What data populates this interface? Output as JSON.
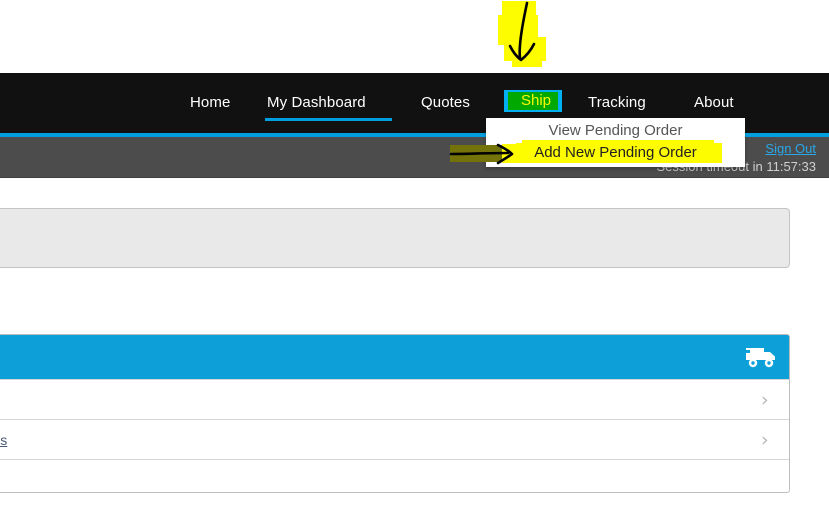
{
  "navbar": {
    "items": [
      {
        "label": "Home",
        "name": "nav-item-home",
        "active": false
      },
      {
        "label": "My Dashboard",
        "name": "nav-item-my-dashboard",
        "active": true
      },
      {
        "label": "Quotes",
        "name": "nav-item-quotes",
        "active": false
      },
      {
        "label": "Ship",
        "name": "nav-item-ship",
        "active": false,
        "highlighted": true
      },
      {
        "label": "Tracking",
        "name": "nav-item-tracking",
        "active": false
      },
      {
        "label": "About",
        "name": "nav-item-about",
        "active": false
      }
    ],
    "settings_icon": "gear-icon",
    "active_underline_color": "#00a0e0",
    "background_color": "#111111",
    "ship_highlight_background": "#00a800",
    "ship_highlight_text_color": "#f9f900",
    "ship_outer_highlight_color": "#00b0f0"
  },
  "dropdown": {
    "items": [
      {
        "label": "View Pending Order",
        "name": "dropdown-item-view-pending-order",
        "highlighted": false
      },
      {
        "label": "Add New Pending Order",
        "name": "dropdown-item-add-new-pending-order",
        "highlighted": true
      }
    ],
    "highlight_color": "#fdfd00",
    "background_color": "#ffffff"
  },
  "session_bar": {
    "sign_out_label": "Sign Out",
    "timeout_text": "Session timeout in 11:57:33",
    "timeout_value": "11:57:33",
    "background_color": "#4c4c4c",
    "link_color": "#29a7e8"
  },
  "annotations": [
    {
      "name": "down-arrow-annotation",
      "type": "arrow",
      "direction": "down",
      "highlight_color": "#fdfd00",
      "stroke_color": "#000000"
    },
    {
      "name": "pointer-arrow-annotation",
      "type": "arrow",
      "direction": "right",
      "highlight_color": "#fdfd00",
      "stroke_color": "#000000"
    }
  ],
  "content": {
    "gray_panel": {
      "name": "empty-gray-panel",
      "background_color": "#e9e9e9",
      "border_color": "#c4c4c4"
    },
    "shipment_card": {
      "header_color": "#0d9fd8",
      "header_icon": "truck-icon",
      "rows": [
        {
          "name": "card-row-1",
          "label": "",
          "chevron": "›"
        },
        {
          "name": "card-row-2",
          "label": "uotes",
          "chevron": "›"
        },
        {
          "name": "card-row-3",
          "label": "",
          "chevron": ""
        }
      ]
    }
  }
}
